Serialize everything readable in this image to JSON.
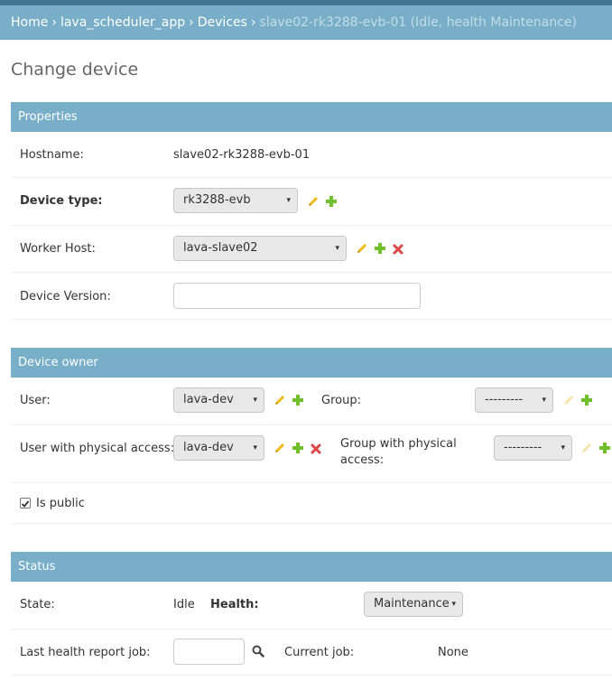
{
  "breadcrumb": {
    "home": "Home",
    "app": "lava_scheduler_app",
    "section": "Devices",
    "current": "slave02-rk3288-evb-01 (Idle, health Maintenance)",
    "separator": "›"
  },
  "page_title": "Change device",
  "properties": {
    "header": "Properties",
    "hostname_label": "Hostname:",
    "hostname_value": "slave02-rk3288-evb-01",
    "device_type_label": "Device type:",
    "device_type_value": "rk3288-evb",
    "worker_host_label": "Worker Host:",
    "worker_host_value": "lava-slave02",
    "device_version_label": "Device Version:",
    "device_version_value": ""
  },
  "device_owner": {
    "header": "Device owner",
    "user_label": "User:",
    "user_value": "lava-dev",
    "group_label": "Group:",
    "group_value": "---------",
    "physical_user_label": "User with physical access:",
    "physical_user_value": "lava-dev",
    "physical_group_label_line1": "Group with physical",
    "physical_group_label_line2": "access:",
    "physical_group_value": "---------",
    "is_public_label": "Is public",
    "is_public_checked": true
  },
  "status": {
    "header": "Status",
    "state_label": "State:",
    "state_value": "Idle",
    "health_label": "Health:",
    "health_value": "Maintenance",
    "last_health_job_label": "Last health report job:",
    "last_health_job_value": "",
    "current_job_label": "Current job:",
    "current_job_value": "None"
  },
  "icons": {
    "select_arrow": "▾",
    "edit": "pencil-icon",
    "add": "plus-icon",
    "delete": "x-icon",
    "lookup": "search-icon"
  },
  "colors": {
    "header_bg": "#79aec8",
    "topbar": "#417690",
    "edit_icon": "#efb80b",
    "edit_icon_disabled": "#f4e2a8",
    "add_icon": "#70bf2b",
    "delete_icon": "#dd4646"
  }
}
